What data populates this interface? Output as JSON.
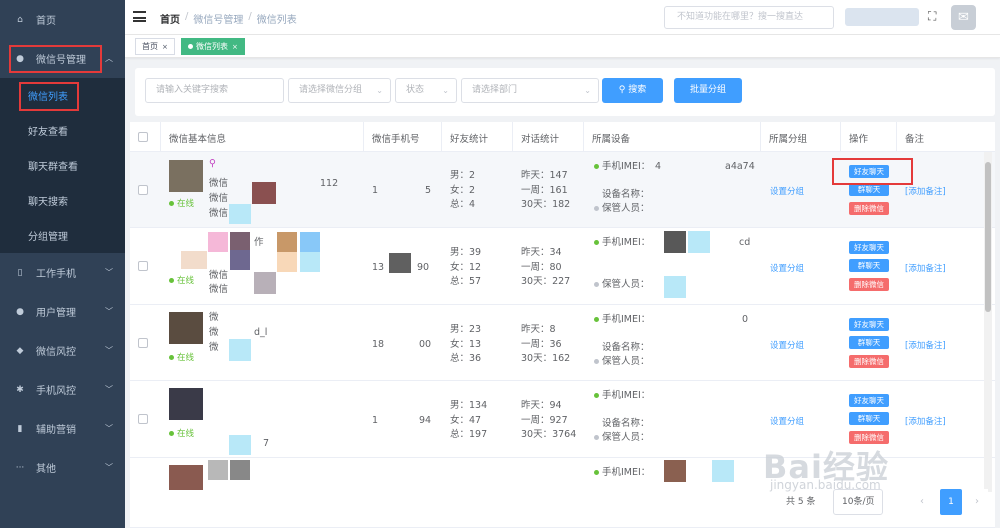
{
  "sidebar": {
    "home": "首页",
    "wechat_mgmt": "微信号管理",
    "sub_items": [
      "微信列表",
      "好友查看",
      "聊天群查看",
      "聊天搜索",
      "分组管理"
    ],
    "items": [
      "工作手机",
      "用户管理",
      "微信风控",
      "手机风控",
      "辅助营销",
      "其他"
    ]
  },
  "header": {
    "breadcrumb": [
      "首页",
      "微信号管理",
      "微信列表"
    ],
    "search_placeholder": "不知道功能在哪里？搜一搜直达"
  },
  "tags": {
    "home": "首页",
    "active": "微信列表"
  },
  "filters": {
    "keyword": "请输入关键字搜索",
    "group": "请选择微信分组",
    "status": "状态",
    "dept": "请选择部门",
    "search_btn": "搜索",
    "batch_btn": "批量分组"
  },
  "table": {
    "headers": [
      "微信基本信息",
      "微信手机号",
      "好友统计",
      "对话统计",
      "所属设备",
      "所属分组",
      "操作",
      "备注"
    ],
    "rows": [
      {
        "info_frag": "112",
        "info_pre": "微信",
        "phone_pre": "1",
        "phone_suf": "5",
        "male": "男：2",
        "female": "女：2",
        "total": "总：4",
        "yesterday": "昨天：147",
        "week": "一周：161",
        "month": "30天：182",
        "imei": "手机IMEI：",
        "imei_frag1": "4",
        "imei_frag2": "a4a74",
        "dev_name": "设备名称：",
        "keeper": "保管人员：",
        "status": "在线",
        "set_group": "设置分组",
        "add_note": "[添加备注]"
      },
      {
        "info_frag": "作",
        "info_pre": "微信",
        "phone_pre": "13",
        "phone_suf": "90",
        "male": "男：39",
        "female": "女：12",
        "total": "总：57",
        "yesterday": "昨天：34",
        "week": "一周：80",
        "month": "30天：227",
        "imei": "手机IMEI：",
        "imei_frag1": "",
        "imei_frag2": "cd",
        "dev_name": "设备名称：",
        "keeper": "保管人员：",
        "status": "在线",
        "set_group": "设置分组",
        "add_note": "[添加备注]"
      },
      {
        "info_frag": "d_l",
        "info_pre": "微",
        "phone_pre": "18",
        "phone_suf": "00",
        "male": "男：23",
        "female": "女：13",
        "total": "总：36",
        "yesterday": "昨天：8",
        "week": "一周：36",
        "month": "30天：162",
        "imei": "手机IMEI：",
        "imei_frag1": "",
        "imei_frag2": "0",
        "dev_name": "设备名称：",
        "keeper": "保管人员：",
        "status": "在线",
        "set_group": "设置分组",
        "add_note": "[添加备注]"
      },
      {
        "info_frag": "7",
        "info_pre": "",
        "phone_pre": "1",
        "phone_suf": "94",
        "male": "男：134",
        "female": "女：47",
        "total": "总：197",
        "yesterday": "昨天：94",
        "week": "一周：927",
        "month": "30天：3764",
        "imei": "手机IMEI：",
        "imei_frag1": "",
        "imei_frag2": "",
        "dev_name": "设备名称：",
        "keeper": "保管人员：",
        "status": "在线",
        "set_group": "设置分组",
        "add_note": "[添加备注]"
      },
      {
        "imei": "手机IMEI："
      }
    ],
    "actions": {
      "chat": "好友聊天",
      "group_chat": "群聊天",
      "delete": "删除微信"
    }
  },
  "pager": {
    "total": "共 5 条",
    "size": "10条/页",
    "page": "1"
  },
  "watermark": {
    "brand": "Bai经验",
    "url": "jingyan.baidu.com"
  }
}
